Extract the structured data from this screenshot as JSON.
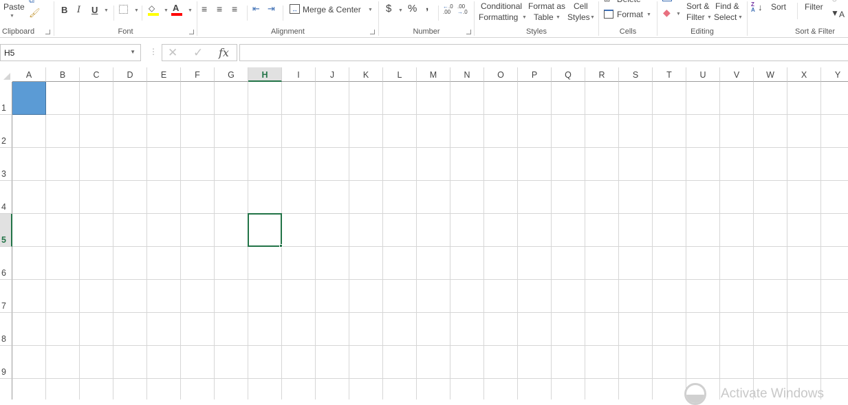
{
  "ribbon": {
    "groups": {
      "clipboard": {
        "label": "Clipboard",
        "paste": "Paste"
      },
      "font": {
        "label": "Font",
        "bold": "B",
        "italic": "I",
        "underline": "U"
      },
      "alignment": {
        "label": "Alignment",
        "merge_center": "Merge & Center"
      },
      "number": {
        "label": "Number",
        "currency": "$",
        "percent": "%",
        "comma": ",",
        "increase_decimal": "←.0 .00",
        "decrease_decimal": ".00 →.0"
      },
      "styles": {
        "label": "Styles",
        "conditional_line1": "Conditional",
        "conditional_line2": "Formatting",
        "format_table_line1": "Format as",
        "format_table_line2": "Table",
        "cell_styles_line1": "Cell",
        "cell_styles_line2": "Styles"
      },
      "cells": {
        "label": "Cells",
        "delete": "Delete",
        "format": "Format"
      },
      "editing": {
        "label": "Editing",
        "sort_filter_line1": "Sort &",
        "sort_filter_line2": "Filter",
        "find_select_line1": "Find &",
        "find_select_line2": "Select"
      },
      "sort_filter": {
        "label": "Sort & Filter",
        "sort": "Sort",
        "filter": "Filter",
        "advanced": "A"
      }
    },
    "colors": {
      "highlight": "#ffff00",
      "font_color": "#ff0000"
    }
  },
  "formula_bar": {
    "name_box": "H5",
    "fx": "fx",
    "cancel": "✕",
    "enter": "✓",
    "formula": ""
  },
  "sheet": {
    "columns": [
      "A",
      "B",
      "C",
      "D",
      "E",
      "F",
      "G",
      "H",
      "I",
      "J",
      "K",
      "L",
      "M",
      "N",
      "O",
      "P",
      "Q",
      "R",
      "S",
      "T",
      "U",
      "V",
      "W",
      "X",
      "Y"
    ],
    "rows": [
      "1",
      "2",
      "3",
      "4",
      "5",
      "6",
      "7",
      "8",
      "9"
    ],
    "selected_column": "H",
    "selected_row": "5",
    "active_cell": "H5",
    "filled_cell": "A1",
    "filled_cell_color": "#5b9bd5",
    "accent_color": "#217346"
  },
  "watermark": {
    "text": "Activate Windows"
  }
}
